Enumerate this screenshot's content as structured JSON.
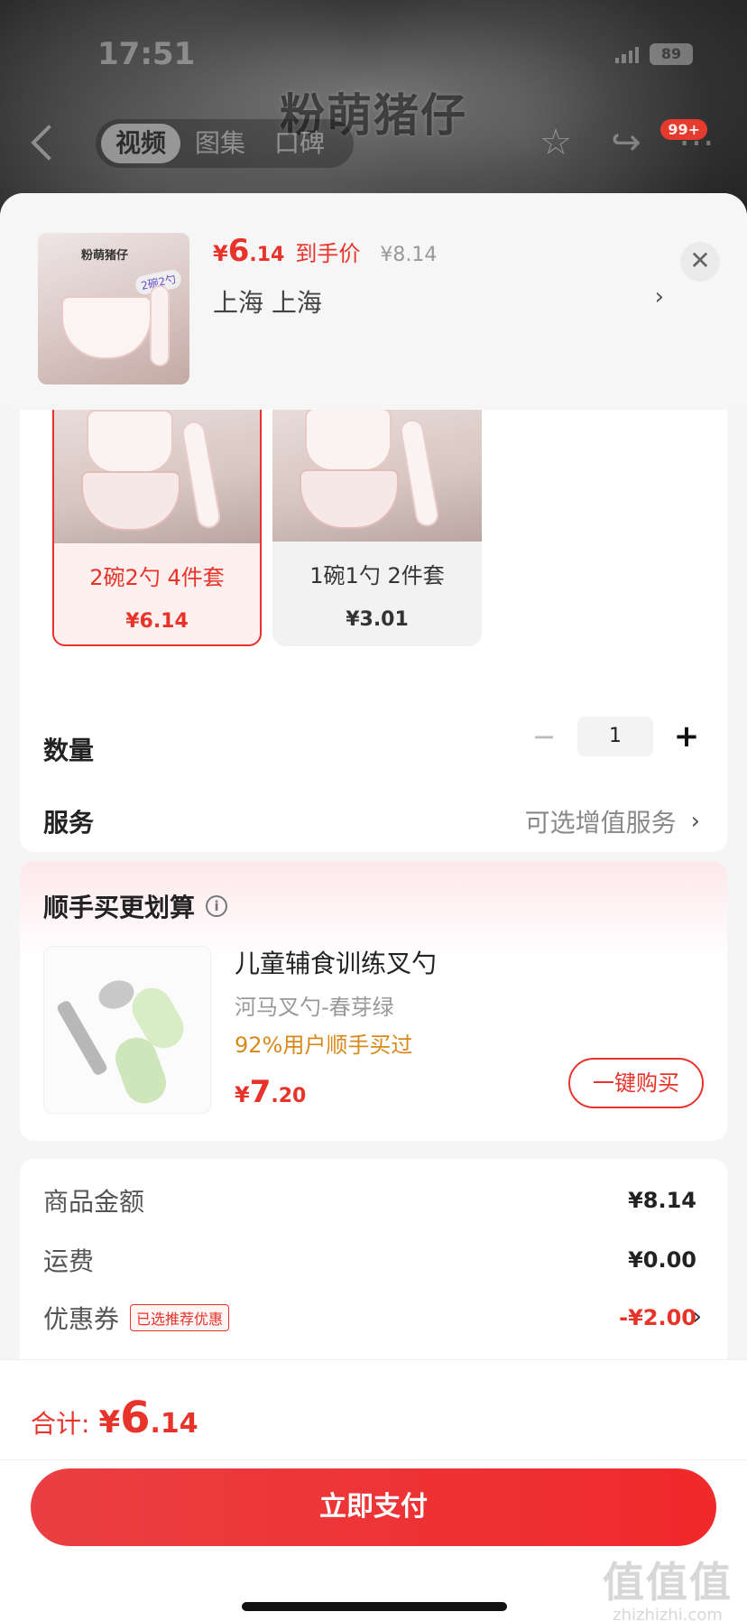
{
  "status_bar": {
    "time": "17:51",
    "battery": "89"
  },
  "background_page": {
    "title_overlay": "粉萌猪仔",
    "tabs": [
      {
        "label": "视频",
        "active": true
      },
      {
        "label": "图集",
        "active": false
      },
      {
        "label": "口碑",
        "active": false
      }
    ],
    "notification_badge": "99+"
  },
  "sheet_header": {
    "thumbnail_label": "粉萌猪仔",
    "thumbnail_tag": "2碗2勺",
    "price": {
      "currency": "¥",
      "integer": "6",
      "decimal": ".14",
      "note": "到手价",
      "original": "¥8.14"
    },
    "location": "上海  上海",
    "close_icon": "✕"
  },
  "sku_options": [
    {
      "name": "2碗2勺 4件套",
      "price": "¥6.14",
      "selected": true
    },
    {
      "name": "1碗1勺 2件套",
      "price": "¥3.01",
      "selected": false
    }
  ],
  "quantity": {
    "label": "数量",
    "value": "1",
    "minus": "−",
    "plus": "+"
  },
  "service": {
    "label": "服务",
    "value": "可选增值服务",
    "chevron": "›"
  },
  "addon": {
    "title": "顺手买更划算",
    "info_icon": "i",
    "product_name": "儿童辅食训练叉勺",
    "variant": "河马叉勺-春芽绿",
    "stat": "92%用户顺手买过",
    "price": {
      "currency": "¥",
      "integer": "7",
      "decimal": ".20"
    },
    "buy_label": "一键购买"
  },
  "summary": {
    "goods_label": "商品金额",
    "goods_value": "¥8.14",
    "shipping_label": "运费",
    "shipping_value": "¥0.00",
    "coupon_label": "优惠券",
    "coupon_tag": "已选推荐优惠",
    "coupon_value": "-¥2.00",
    "chevron": "›"
  },
  "footer": {
    "total_label": "合计:",
    "total": {
      "currency": "¥",
      "integer": "6",
      "decimal": ".14"
    },
    "pay_label": "立即支付"
  },
  "watermark": {
    "big": "值值值",
    "small": "zhizhizhi.com"
  },
  "colors": {
    "accent": "#e8332a",
    "addon_stat": "#d8891c"
  }
}
